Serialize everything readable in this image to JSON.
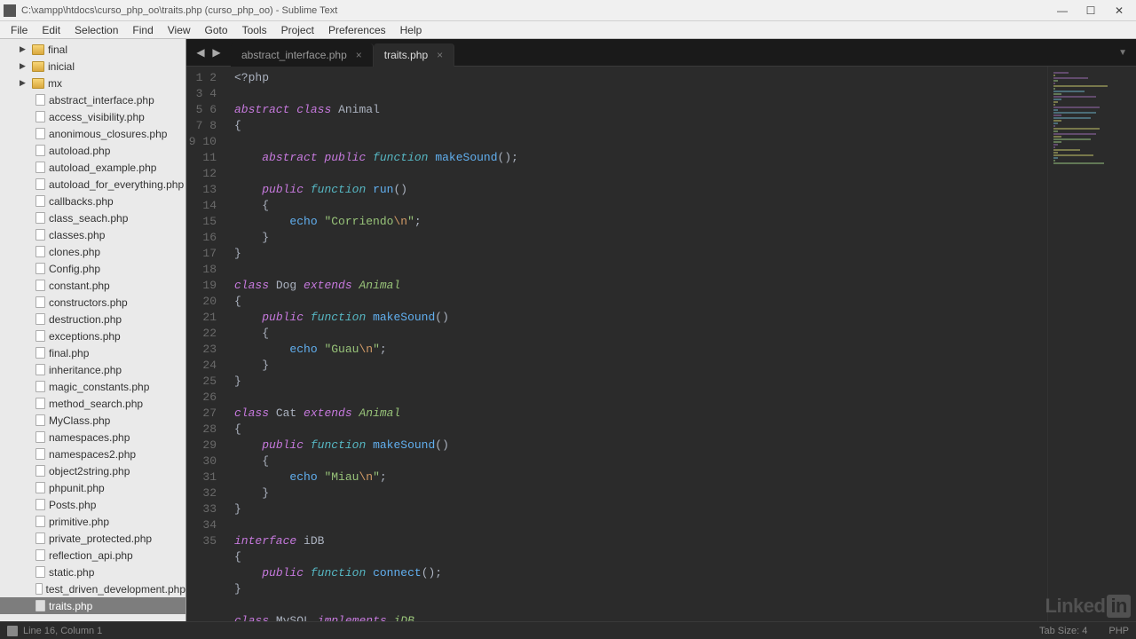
{
  "window": {
    "title": "C:\\xampp\\htdocs\\curso_php_oo\\traits.php (curso_php_oo) - Sublime Text"
  },
  "menu": [
    "File",
    "Edit",
    "Selection",
    "Find",
    "View",
    "Goto",
    "Tools",
    "Project",
    "Preferences",
    "Help"
  ],
  "sidebar": {
    "folders": [
      {
        "name": "final",
        "expanded": false
      },
      {
        "name": "inicial",
        "expanded": false
      },
      {
        "name": "mx",
        "expanded": false
      }
    ],
    "files": [
      "abstract_interface.php",
      "access_visibility.php",
      "anonimous_closures.php",
      "autoload.php",
      "autoload_example.php",
      "autoload_for_everything.php",
      "callbacks.php",
      "class_seach.php",
      "classes.php",
      "clones.php",
      "Config.php",
      "constant.php",
      "constructors.php",
      "destruction.php",
      "exceptions.php",
      "final.php",
      "inheritance.php",
      "magic_constants.php",
      "method_search.php",
      "MyClass.php",
      "namespaces.php",
      "namespaces2.php",
      "object2string.php",
      "phpunit.php",
      "Posts.php",
      "primitive.php",
      "private_protected.php",
      "reflection_api.php",
      "static.php",
      "test_driven_development.php",
      "traits.php"
    ],
    "active_file": "traits.php"
  },
  "tabs": [
    {
      "label": "abstract_interface.php",
      "active": false
    },
    {
      "label": "traits.php",
      "active": true
    }
  ],
  "code_lines": 35,
  "statusbar": {
    "position": "Line 16, Column 1",
    "tabsize": "Tab Size: 4",
    "syntax": "PHP"
  },
  "watermark": {
    "brand": "Linked",
    "suffix": "in"
  }
}
